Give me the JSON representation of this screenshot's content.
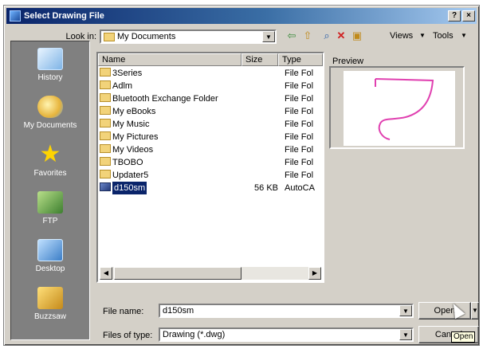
{
  "window": {
    "title": "Select Drawing File",
    "help_btn": "?",
    "close_btn": "×"
  },
  "places": [
    {
      "label": "History",
      "icon": "history-icon"
    },
    {
      "label": "My Documents",
      "icon": "my-documents-icon"
    },
    {
      "label": "Favorites",
      "icon": "favorites-star-icon"
    },
    {
      "label": "FTP",
      "icon": "ftp-icon"
    },
    {
      "label": "Desktop",
      "icon": "desktop-icon"
    },
    {
      "label": "Buzzsaw",
      "icon": "buzzsaw-icon"
    }
  ],
  "lookin": {
    "label": "Look in:",
    "value": "My Documents"
  },
  "toolbar": {
    "views_label": "Views",
    "tools_label": "Tools"
  },
  "filelist": {
    "columns": {
      "name": "Name",
      "size": "Size",
      "type": "Type"
    },
    "rows": [
      {
        "name": "3Series",
        "size": "",
        "type": "File Fol"
      },
      {
        "name": "Adlm",
        "size": "",
        "type": "File Fol"
      },
      {
        "name": "Bluetooth Exchange Folder",
        "size": "",
        "type": "File Fol"
      },
      {
        "name": "My eBooks",
        "size": "",
        "type": "File Fol"
      },
      {
        "name": "My Music",
        "size": "",
        "type": "File Fol"
      },
      {
        "name": "My Pictures",
        "size": "",
        "type": "File Fol"
      },
      {
        "name": "My Videos",
        "size": "",
        "type": "File Fol"
      },
      {
        "name": "TBOBO",
        "size": "",
        "type": "File Fol"
      },
      {
        "name": "Updater5",
        "size": "",
        "type": "File Fol"
      },
      {
        "name": "d150sm",
        "size": "56 KB",
        "type": "AutoCA"
      }
    ]
  },
  "preview": {
    "label": "Preview"
  },
  "filename": {
    "label": "File name:",
    "value": "d150sm"
  },
  "filetype": {
    "label": "Files of type:",
    "value": "Drawing (*.dwg)"
  },
  "buttons": {
    "open": "Open",
    "cancel": "Cancel"
  },
  "tooltip": "Open"
}
